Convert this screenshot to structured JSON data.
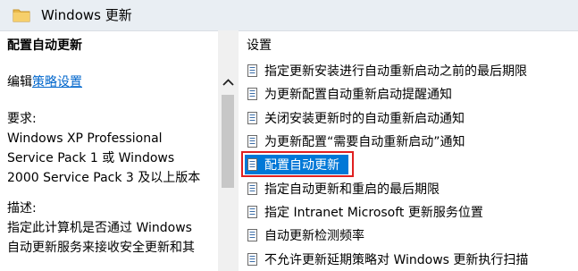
{
  "header": {
    "title": "Windows 更新",
    "icon": "folder-icon"
  },
  "left_pane": {
    "policy_name": "配置自动更新",
    "edit_prefix": "编辑",
    "edit_link": "策略设置",
    "requirements_label": "要求:",
    "requirements_text": "Windows XP Professional\nService Pack 1 或 Windows\n2000 Service Pack 3 及以上版本",
    "description_label": "描述:",
    "description_text": "指定此计算机是否通过 Windows\n自动更新服务来接收安全更新和其"
  },
  "right_pane": {
    "settings_header": "设置",
    "items": [
      {
        "label": "指定更新安装进行自动重新启动之前的最后期限"
      },
      {
        "label": "为更新配置自动重新启动提醒通知"
      },
      {
        "label": "关闭安装更新时的自动重新启动通知"
      },
      {
        "label": "为更新配置“需要自动重新启动”通知"
      },
      {
        "label": "配置自动更新",
        "selected": true
      },
      {
        "label": "指定自动更新和重启的最后期限"
      },
      {
        "label": "指定 Intranet Microsoft 更新服务位置"
      },
      {
        "label": "自动更新检测频率"
      },
      {
        "label": "不允许更新延期策略对 Windows 更新执行扫描"
      }
    ]
  },
  "colors": {
    "header_bg": "#e9eef3",
    "link": "#0066cc",
    "selection": "#0078d7",
    "highlight_border": "#e02020",
    "folder": "#e8b84a"
  }
}
